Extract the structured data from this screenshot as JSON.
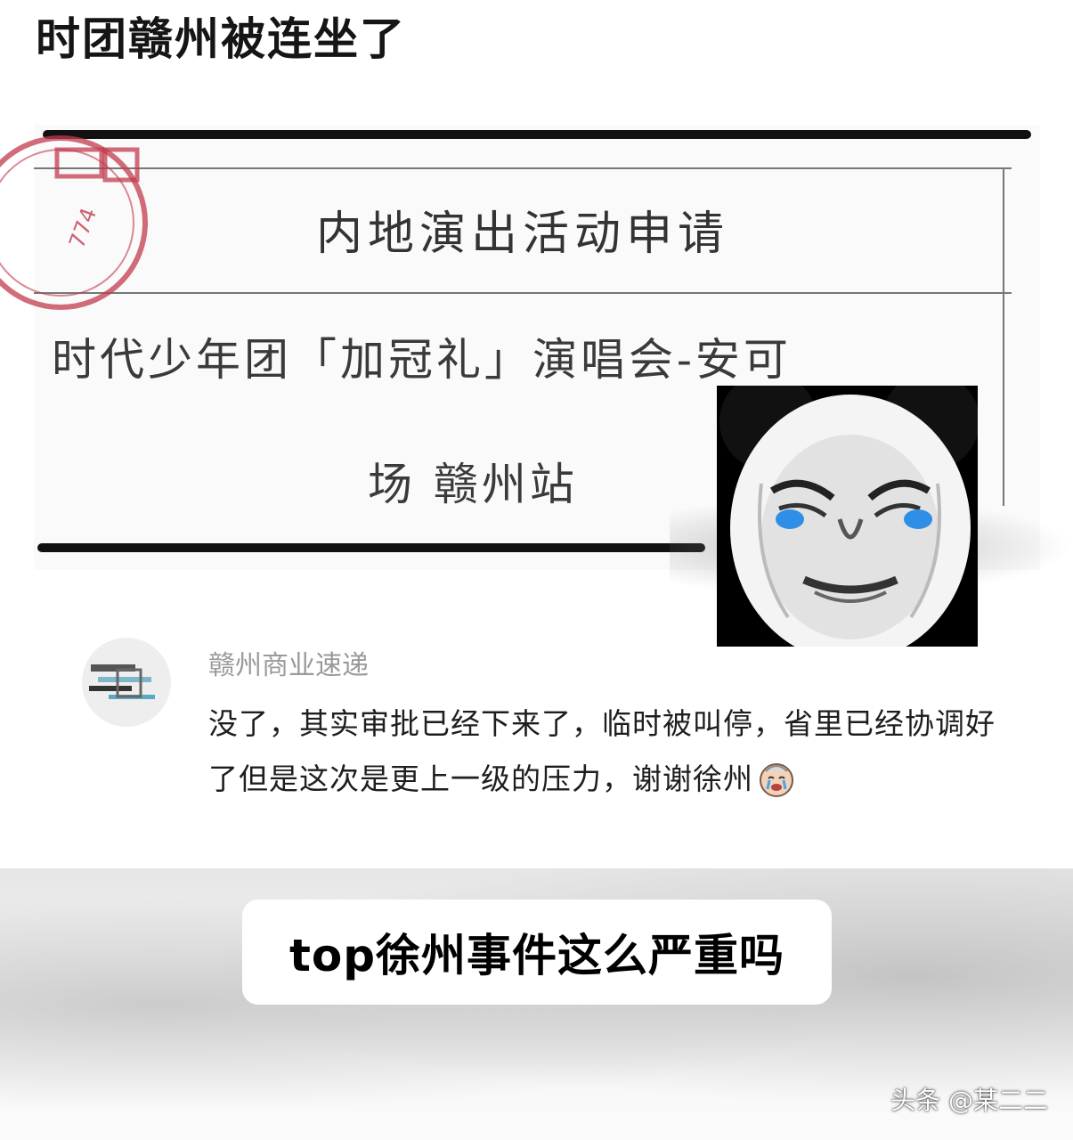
{
  "post": {
    "title": "时团赣州被连坐了"
  },
  "document": {
    "heading": "内地演出活动申请",
    "line1": "时代少年团「加冠礼」演唱会-安可",
    "line2": "场 赣州站",
    "stamp_digits": "774",
    "stamp_color": "#c23b4e"
  },
  "meme": {
    "icon": "crying-panda-face-icon",
    "tear_color": "#2f8fe6"
  },
  "comment": {
    "author": "赣州商业速递",
    "body": "没了，其实审批已经下来了，临时被叫停，省里已经协调好了但是这次是更上一级的压力，谢谢徐州",
    "emoji": "crying-face-emoji-icon"
  },
  "caption": {
    "text": "top徐州事件这么严重吗"
  },
  "watermark": {
    "text": "头条 @某二二"
  }
}
